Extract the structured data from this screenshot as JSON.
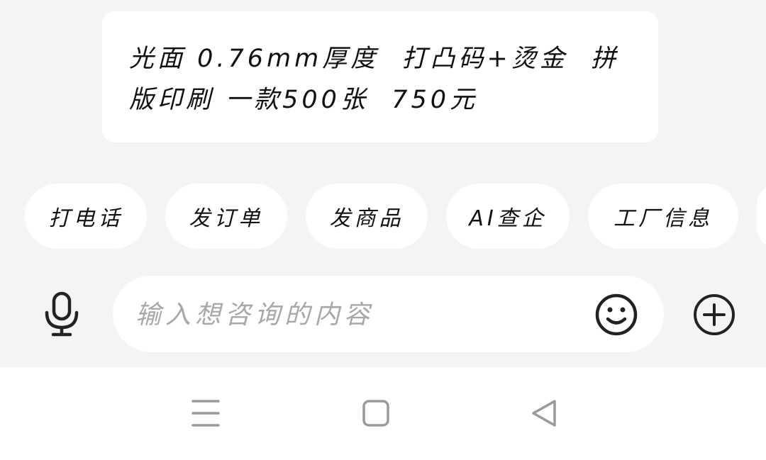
{
  "message": {
    "text": "光面 0.76mm厚度  打凸码+烫金  拼\n版印刷 一款500张  750元"
  },
  "quick_actions": [
    {
      "label": "打电话"
    },
    {
      "label": "发订单"
    },
    {
      "label": "发商品"
    },
    {
      "label": "AI查企"
    },
    {
      "label": "工厂信息"
    }
  ],
  "composer": {
    "placeholder": "输入想咨询的内容",
    "value": "",
    "voice_icon": "microphone-icon",
    "emoji_icon": "smiley-icon",
    "add_icon": "plus-circle-icon"
  },
  "nav_bar": {
    "menu_icon": "menu-icon",
    "home_icon": "square-home-icon",
    "back_icon": "triangle-back-icon"
  },
  "colors": {
    "background": "#f4f4f4",
    "surface": "#ffffff",
    "icon": "#222222",
    "nav_icon": "#9a9a9a",
    "placeholder": "#a8a8a8"
  }
}
